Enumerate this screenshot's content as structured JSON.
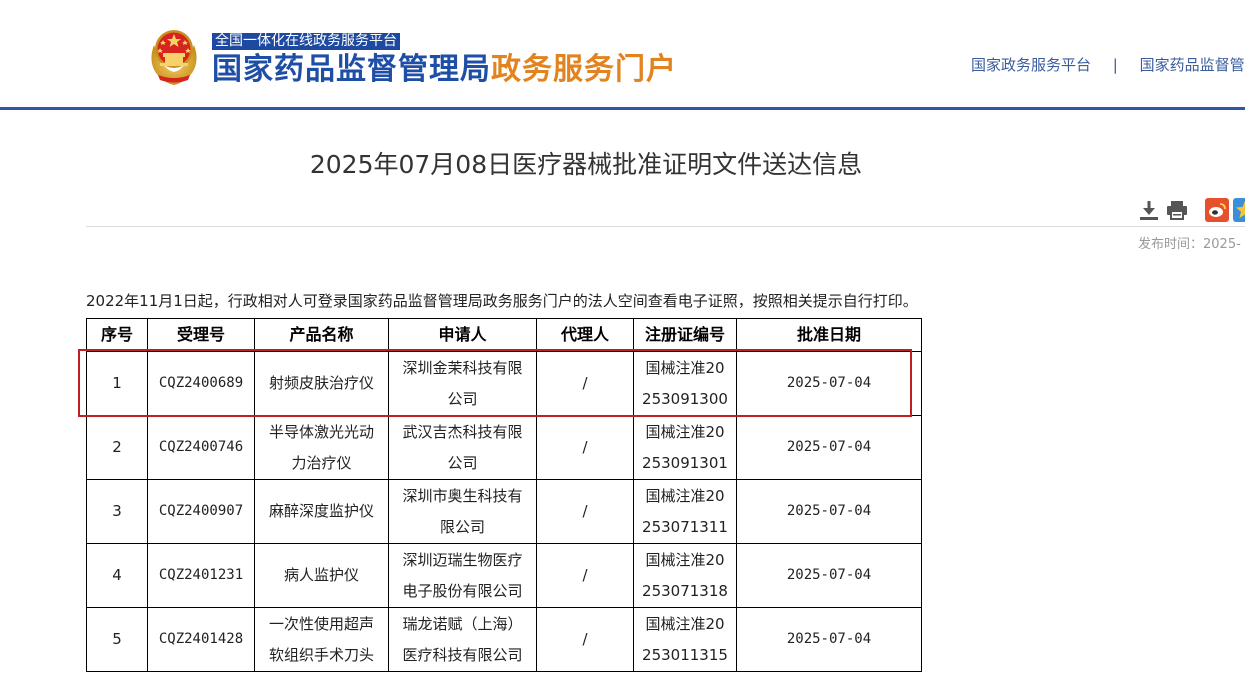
{
  "header": {
    "subtitle": "全国一体化在线政务服务平台",
    "title_main": "国家药品监督管理局",
    "title_accent": "政务服务门户",
    "links": [
      "国家政务服务平台",
      "国家药品监督管"
    ],
    "separator": "|"
  },
  "article": {
    "title": "2025年07月08日医疗器械批准证明文件送达信息",
    "publish_time": "发布时间：2025-",
    "notice": "2022年11月1日起，行政相对人可登录国家药品监督管理局政务服务门户的法人空间查看电子证照，按照相关提示自行打印。"
  },
  "toolbar": {
    "icons": [
      "download-icon",
      "print-icon",
      "weibo-icon",
      "star-icon"
    ]
  },
  "table": {
    "headers": [
      "序号",
      "受理号",
      "产品名称",
      "申请人",
      "代理人",
      "注册证编号",
      "批准日期"
    ],
    "rows": [
      [
        "1",
        "CQZ2400689",
        "射频皮肤治疗仪",
        "深圳金茉科技有限公司",
        "/",
        "国械注准20253091300",
        "2025-07-04"
      ],
      [
        "2",
        "CQZ2400746",
        "半导体激光光动力治疗仪",
        "武汉吉杰科技有限公司",
        "/",
        "国械注准20253091301",
        "2025-07-04"
      ],
      [
        "3",
        "CQZ2400907",
        "麻醉深度监护仪",
        "深圳市奥生科技有限公司",
        "/",
        "国械注准20253071311",
        "2025-07-04"
      ],
      [
        "4",
        "CQZ2401231",
        "病人监护仪",
        "深圳迈瑞生物医疗电子股份有限公司",
        "/",
        "国械注准20253071318",
        "2025-07-04"
      ],
      [
        "5",
        "CQZ2401428",
        "一次性使用超声软组织手术刀头",
        "瑞龙诺赋（上海）医疗科技有限公司",
        "/",
        "国械注准20253011315",
        "2025-07-04"
      ]
    ]
  },
  "colors": {
    "brand_blue": "#1e4ea5",
    "brand_orange": "#e18420",
    "highlight_red": "#c21f24"
  }
}
